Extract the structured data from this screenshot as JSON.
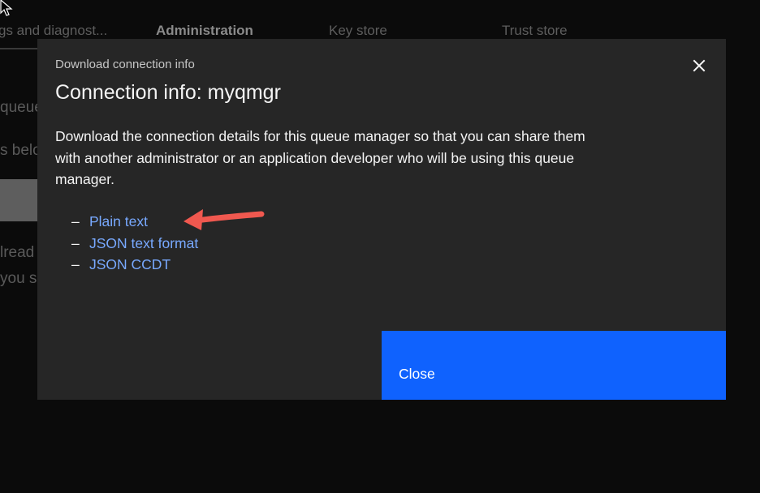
{
  "background": {
    "tabs": [
      {
        "label": "gs and diagnost..."
      },
      {
        "label": "Administration"
      },
      {
        "label": "Key store"
      },
      {
        "label": "Trust store"
      }
    ],
    "fragments": [
      "queue",
      "s belo",
      "lread",
      "you s"
    ]
  },
  "modal": {
    "label": "Download connection info",
    "title": "Connection info: myqmgr",
    "body": "Download the connection details for this queue manager so that you can share them with another administrator or an application developer who will be using this queue manager.",
    "links": [
      {
        "label": "Plain text"
      },
      {
        "label": "JSON text format"
      },
      {
        "label": "JSON CCDT"
      }
    ],
    "list_marker": "–",
    "close_button_label": "Close"
  },
  "icons": {
    "close": "close-icon",
    "cursor": "mouse-cursor-icon",
    "annotation": "red-arrow-annotation"
  },
  "colors": {
    "modal_bg": "#262626",
    "primary_button": "#0f62fe",
    "link": "#78a9ff",
    "annotation_arrow": "#f0584f"
  }
}
